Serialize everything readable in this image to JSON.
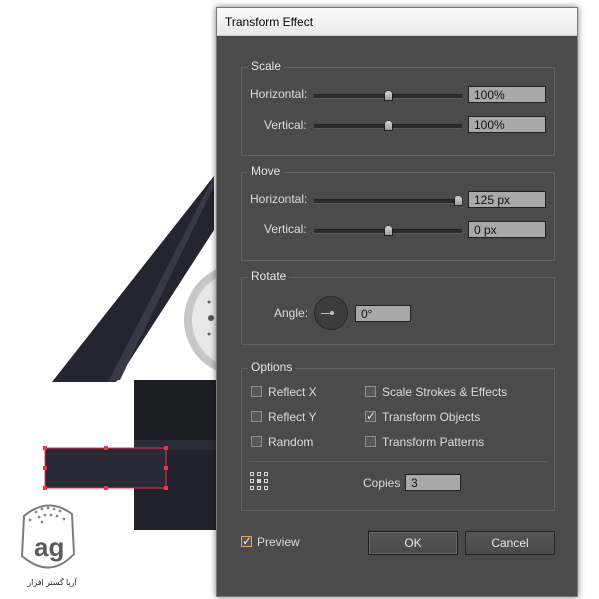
{
  "dialog": {
    "title": "Transform Effect",
    "scale": {
      "group_label": "Scale",
      "horizontal_label": "Horizontal:",
      "horizontal_value": "100%",
      "horizontal_slider": 0.5,
      "vertical_label": "Vertical:",
      "vertical_value": "100%",
      "vertical_slider": 0.5
    },
    "move": {
      "group_label": "Move",
      "horizontal_label": "Horizontal:",
      "horizontal_value": "125 px",
      "horizontal_slider": 0.97,
      "vertical_label": "Vertical:",
      "vertical_value": "0 px",
      "vertical_slider": 0.5
    },
    "rotate": {
      "group_label": "Rotate",
      "angle_label": "Angle:",
      "angle_value": "0°"
    },
    "options": {
      "group_label": "Options",
      "reflect_x": {
        "label": "Reflect X",
        "checked": false
      },
      "reflect_y": {
        "label": "Reflect Y",
        "checked": false
      },
      "random": {
        "label": "Random",
        "checked": false
      },
      "scale_strokes": {
        "label": "Scale Strokes & Effects",
        "checked": false
      },
      "transform_objects": {
        "label": "Transform Objects",
        "checked": true
      },
      "transform_patterns": {
        "label": "Transform Patterns",
        "checked": false
      },
      "reference_point_icon": "reference-point-grid-icon",
      "copies_label": "Copies",
      "copies_value": "3"
    },
    "preview": {
      "label": "Preview",
      "checked": true
    },
    "ok_label": "OK",
    "cancel_label": "Cancel"
  },
  "watermark": {
    "logo_text": "ag",
    "caption": "آریا گستر افزار"
  },
  "colors": {
    "dialog_bg": "#4b4b4b",
    "selection": "#e8364a",
    "preview_check": "#e2a35a"
  }
}
